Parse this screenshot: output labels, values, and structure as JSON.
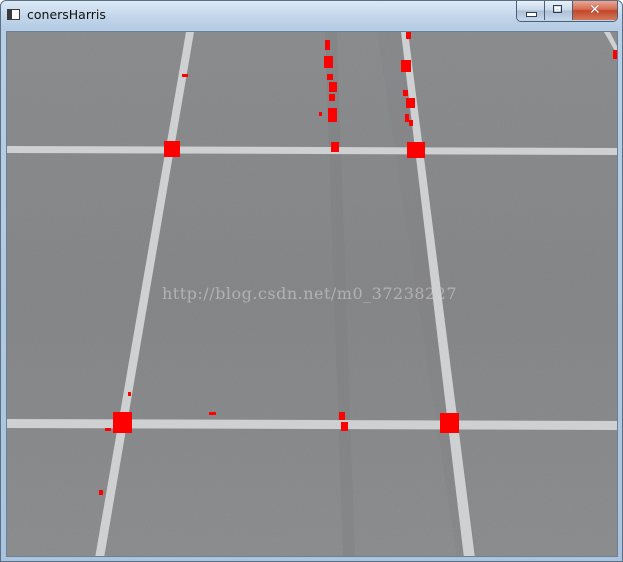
{
  "window": {
    "title": "conersHarris",
    "icon": "app-window-icon",
    "controls": {
      "minimize": "minimize-icon",
      "maximize": "maximize-icon",
      "close": "close-icon"
    }
  },
  "image": {
    "watermark": "http://blog.csdn.net/m0_37238227",
    "colors": {
      "floor": "#8c8d8f",
      "tape": "#cfd0d1",
      "corner_marker": "#ff0000"
    }
  }
}
